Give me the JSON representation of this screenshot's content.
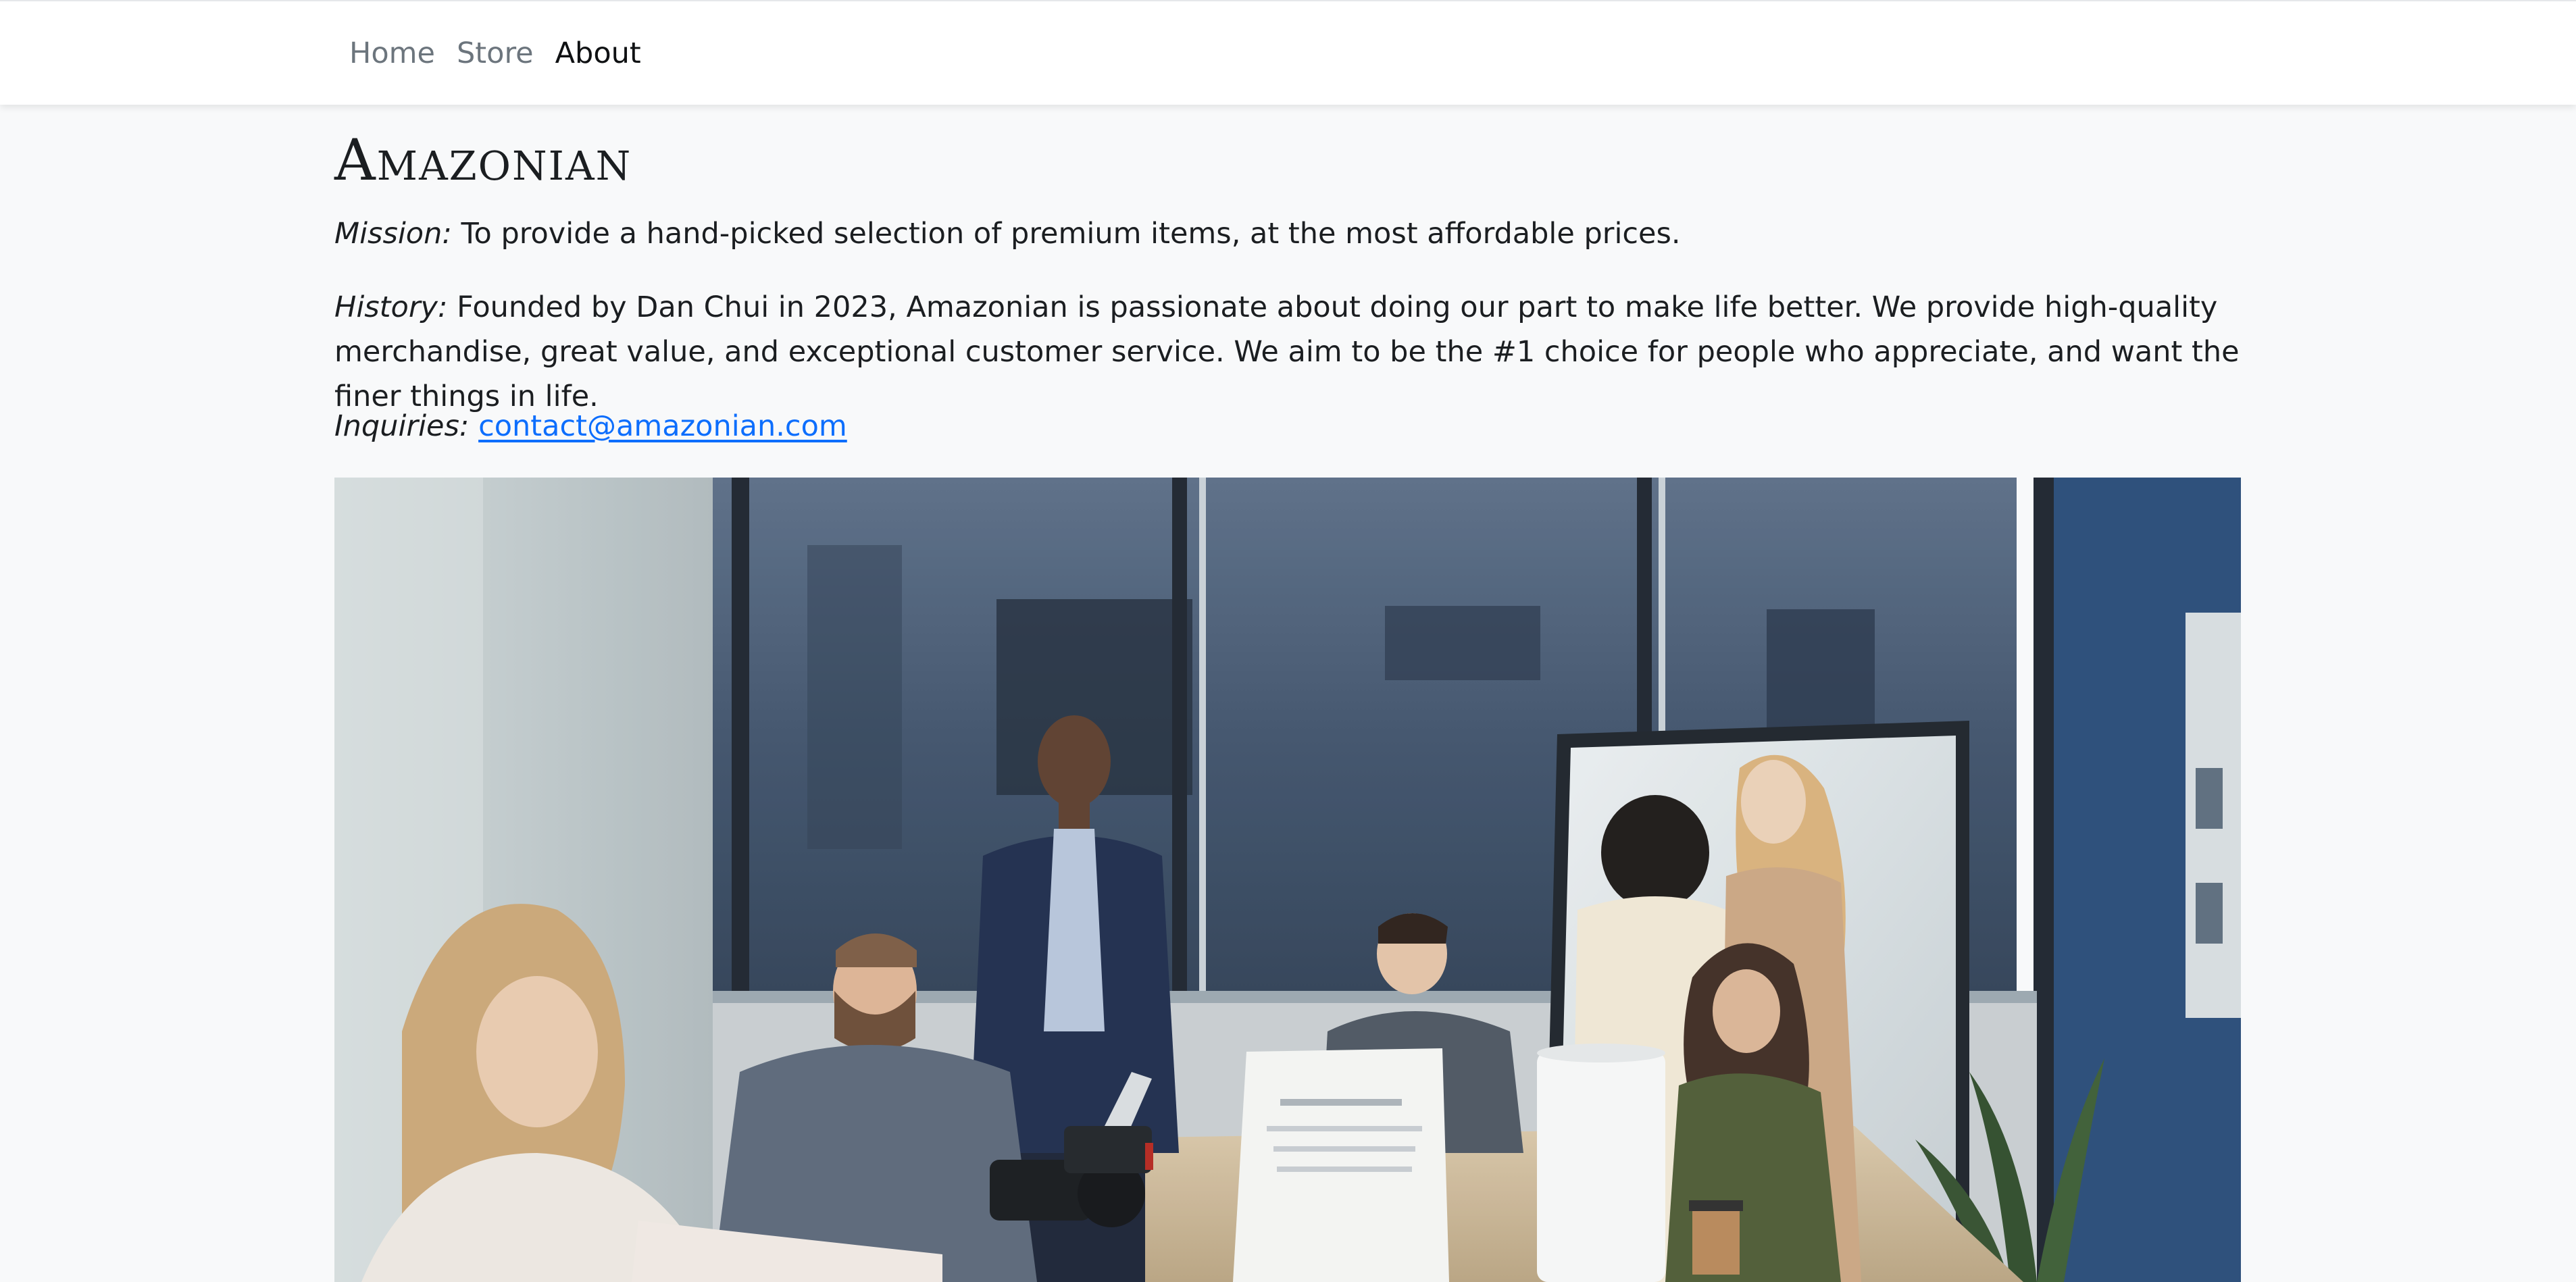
{
  "nav": {
    "items": [
      {
        "label": "Home"
      },
      {
        "label": "Store"
      },
      {
        "label": "About"
      }
    ],
    "active": "About"
  },
  "brand": {
    "title": "Amazonian"
  },
  "about": {
    "mission_label": "Mission:",
    "mission_text": "To provide a hand-picked selection of premium items, at the most affordable prices.",
    "history_label": "History:",
    "history_text": "Founded by Dan Chui in 2023, Amazonian is passionate about doing our part to make life better. We provide high-quality merchandise, great value, and exceptional customer service. We aim to be the #1 choice for people who appreciate, and want the finer things in life.",
    "inquiries_label": "Inquiries:",
    "email": "contact@amazonian.com"
  },
  "photo": {
    "subject": "team meeting around a conference table"
  },
  "colors": {
    "page_background": "#f8f9fa",
    "navbar_background": "#ffffff",
    "nav_link": "#6c757d",
    "nav_link_active": "#0f1113",
    "link": "#0d6efd",
    "text": "#212529"
  }
}
